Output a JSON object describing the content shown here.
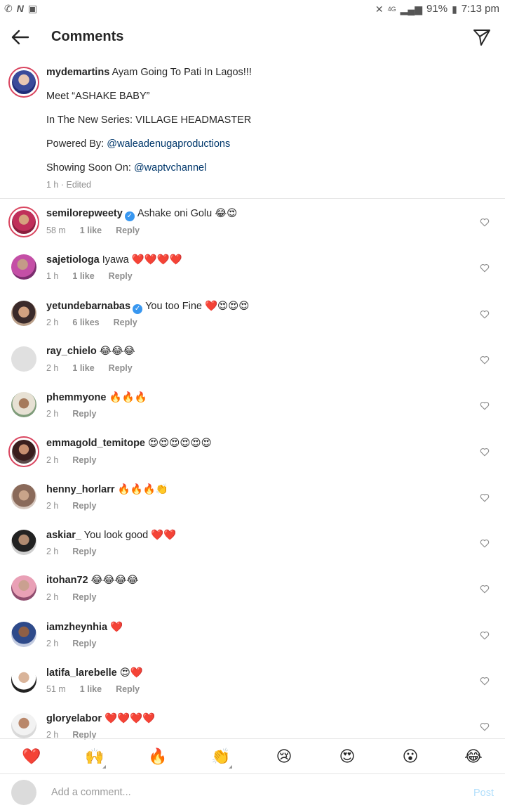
{
  "status_bar": {
    "network": "4G",
    "battery": "91%",
    "time": "7:13 pm"
  },
  "header": {
    "title": "Comments"
  },
  "caption": {
    "username": "mydemartins",
    "lines": [
      "Ayam Going To Pati In Lagos!!!",
      "Meet “ASHAKE BABY”",
      "In The New Series: VILLAGE HEADMASTER",
      "Powered By:",
      "Showing Soon On:"
    ],
    "mention1": "@waleadenugaproductions",
    "mention2": "@waptvchannel",
    "meta": "1 h · Edited"
  },
  "comments": [
    {
      "username": "semilorepweety",
      "text": "Ashake oni Golu 😂😍",
      "time": "58 m",
      "likes": "1 like",
      "reply": "Reply",
      "verified": true
    },
    {
      "username": "sajetiologa",
      "text": "Iyawa ❤️❤️❤️❤️",
      "time": "1 h",
      "likes": "1 like",
      "reply": "Reply"
    },
    {
      "username": "yetundebarnabas",
      "text": "You too Fine ❤️😍😍😍",
      "time": "2 h",
      "likes": "6 likes",
      "reply": "Reply",
      "verified": true
    },
    {
      "username": "ray_chielo",
      "text": "😂😂😂",
      "time": "2 h",
      "likes": "1 like",
      "reply": "Reply"
    },
    {
      "username": "phemmyone",
      "text": "🔥🔥🔥",
      "time": "2 h",
      "likes": "",
      "reply": "Reply"
    },
    {
      "username": "emmagold_temitope",
      "text": "😍😍😍😍😍😍",
      "time": "2 h",
      "likes": "",
      "reply": "Reply"
    },
    {
      "username": "henny_horlarr",
      "text": "🔥🔥🔥👏",
      "time": "2 h",
      "likes": "",
      "reply": "Reply"
    },
    {
      "username": "askiar_",
      "text": "You look good ❤️❤️",
      "time": "2 h",
      "likes": "",
      "reply": "Reply"
    },
    {
      "username": "itohan72",
      "text": "😂😂😂😂",
      "time": "2 h",
      "likes": "",
      "reply": "Reply"
    },
    {
      "username": "iamzheynhia",
      "text": "❤️",
      "time": "2 h",
      "likes": "",
      "reply": "Reply"
    },
    {
      "username": "latifa_larebelle",
      "text": "😍❤️",
      "time": "51 m",
      "likes": "1 like",
      "reply": "Reply"
    },
    {
      "username": "gloryelabor",
      "text": "❤️❤️❤️❤️",
      "time": "2 h",
      "likes": "",
      "reply": "Reply"
    }
  ],
  "emoji_bar": [
    "❤️",
    "🙌",
    "🔥",
    "👏",
    "😢",
    "😍",
    "😮",
    "😂"
  ],
  "composer": {
    "placeholder": "Add a comment...",
    "post_label": "Post"
  },
  "colors": {
    "accent": "#3897f0",
    "mention": "#00376b",
    "meta": "#8e8e8e",
    "post_disabled": "#b2dffc"
  }
}
